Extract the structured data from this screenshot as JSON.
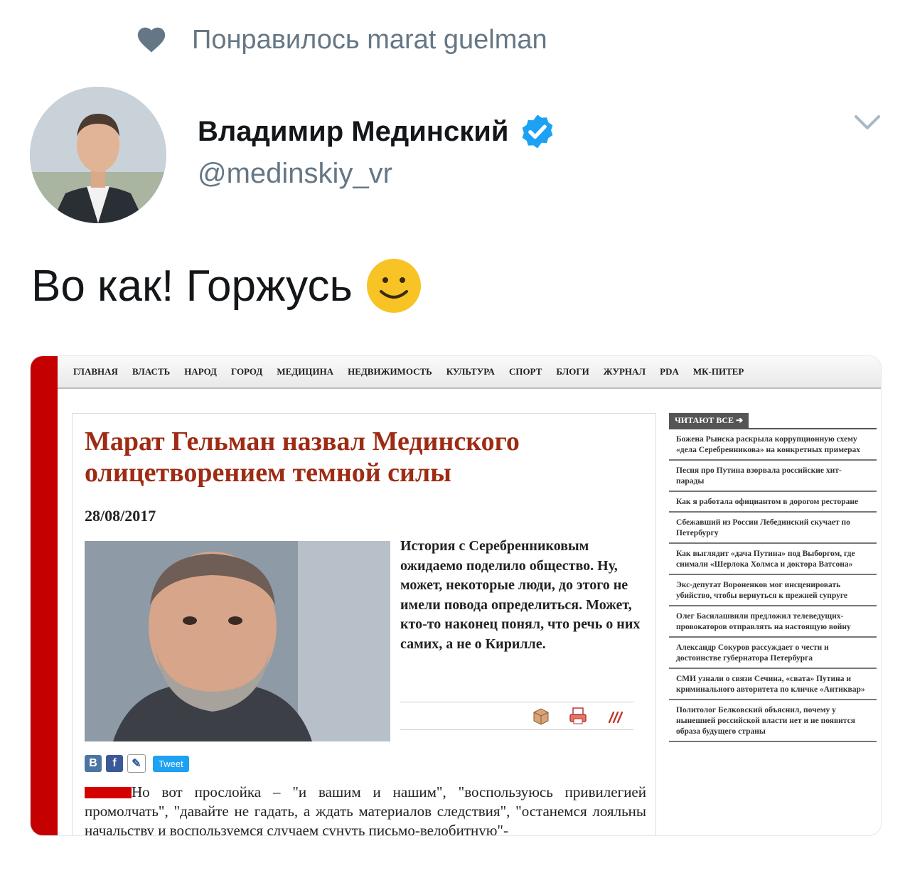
{
  "liked_by": "Понравилось marat guelman",
  "user": {
    "name": "Владимир Мединский",
    "handle": "@medinskiy_vr"
  },
  "tweet": {
    "text": "Во как! Горжусь"
  },
  "colors": {
    "accent_blue": "#1da1f2",
    "gray_text": "#657786",
    "headline_red": "#9e2b14",
    "sidebar_red": "#c40000"
  },
  "embed": {
    "nav": [
      "ГЛАВНАЯ",
      "ВЛАСТЬ",
      "НАРОД",
      "ГОРОД",
      "МЕДИЦИНА",
      "НЕДВИЖИМОСТЬ",
      "КУЛЬТУРА",
      "СПОРТ",
      "БЛОГИ",
      "ЖУРНАЛ",
      "PDA",
      "МК-ПИТЕР"
    ],
    "headline": "Марат Гельман назвал Мединского олицетворением темной силы",
    "date": "28/08/2017",
    "lead": "История с Серебренниковым ожидаемо поделило общество. Ну, может, некоторые люди, до этого не имели повода определиться. Может, кто-то наконец понял, что речь о них самих, а не о Кирилле.",
    "tweet_button": "Tweet",
    "body": "Но вот прослойка – \"и вашим и нашим\", \"воспользуюсь привилегией промолчать\", \"давайте не гадать, а ждать материалов следствия\", \"останемся лояльны начальству и воспользуемся случаем сунуть письмо-велобитную\"-",
    "sidebar_title": "ЧИТАЮТ ВСЕ",
    "sidebar_items": [
      "Божена Рынска раскрыла коррупционную схему «дела Серебренникова» на конкретных примерах",
      "Песня про Путина взорвала российские хит-парады",
      "Как я работала официантом в дорогом ресторане",
      "Сбежавший из России Лебединский скучает по Петербургу",
      "Как выглядит «дача Путина» под Выборгом, где снимали «Шерлока Холмса и доктора Ватсона»",
      "Экс-депутат Вороненков мог инсценировать убийство, чтобы вернуться к прежней супруге",
      "Олег Басилашвили предложил телеведущих-провокаторов отправлять на настоящую войну",
      "Александр Сокуров рассуждает о чести и достоинстве губернатора Петербурга",
      "СМИ узнали о связи Сечина, «свата» Путина и криминального авторитета по кличке «Антиквар»",
      "Политолог Белковский объяснил, почему у нынешней российской власти нет и не появится образа будущего страны"
    ]
  }
}
